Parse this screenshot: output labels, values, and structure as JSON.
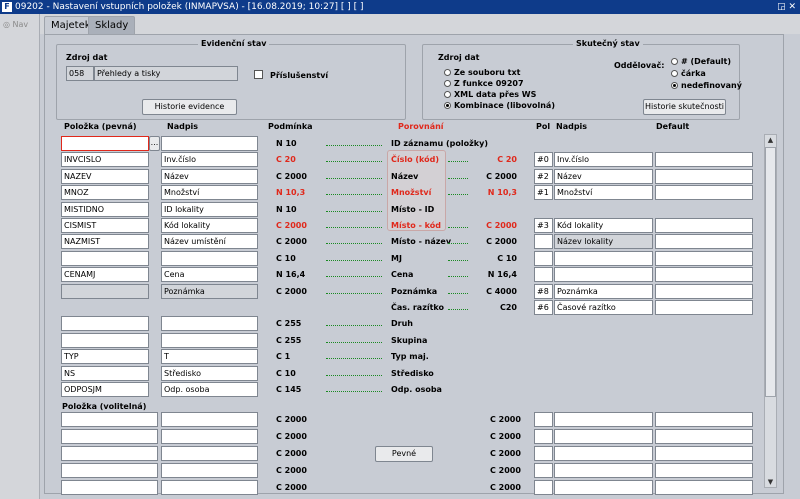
{
  "window": {
    "title": "09202 - Nastavení vstupních položek (INMAPVSA) - [16.08.2019; 10:27]  [ ]  [ ]",
    "icon": "app-icon",
    "controls": "◲ ✕"
  },
  "nav": {
    "label": "Nav"
  },
  "tabs": [
    {
      "label": "Majetek",
      "active": true
    },
    {
      "label": "Sklady",
      "active": false
    }
  ],
  "evid": {
    "title": "Evidenční stav",
    "source_label": "Zdroj dat",
    "source_code": "058",
    "source_name": "Přehledy a tisky",
    "accessory_label": "Příslušenství",
    "history_button": "Historie evidence"
  },
  "actual": {
    "title": "Skutečný stav",
    "source_label": "Zdroj dat",
    "options": [
      {
        "label": "Ze souboru txt",
        "selected": false
      },
      {
        "label": "Z funkce 09207",
        "selected": false
      },
      {
        "label": "XML data přes WS",
        "selected": false
      },
      {
        "label": "Kombinace (libovolná)",
        "selected": true
      }
    ],
    "separator_label": "Oddělovač:",
    "separators": [
      {
        "label": "# (Default)",
        "selected": false
      },
      {
        "label": "čárka",
        "selected": false
      },
      {
        "label": "nedefinovaný",
        "selected": true
      }
    ],
    "history_button": "Historie skutečnosti"
  },
  "headers": {
    "item": "Položka  (pevná)",
    "caption": "Nadpis",
    "condition": "Podmínka",
    "compare": "Porovnání",
    "pol": "Pol",
    "caption2": "Nadpis",
    "default": "Default"
  },
  "rows": [
    {
      "item": "",
      "caption": "",
      "cond": "N 10",
      "cond_red": false,
      "cmp": "ID záznamu (položky)",
      "cmp_red": false,
      "rcond": "",
      "pol": "",
      "cap2": "",
      "def": "",
      "has_right": false,
      "dots_r": false
    },
    {
      "item": "INVCISLO",
      "caption": "Inv.číslo",
      "cond": "C 20",
      "cond_red": true,
      "cmp": "Číslo (kód)",
      "cmp_red": true,
      "rcond": "C 20",
      "rcond_red": true,
      "pol": "#0",
      "cap2": "Inv.číslo",
      "def": "",
      "has_right": true,
      "dots_r": true
    },
    {
      "item": "NAZEV",
      "caption": "Název",
      "cond": "C 2000",
      "cond_red": false,
      "cmp": "Název",
      "cmp_red": false,
      "rcond": "C 2000",
      "pol": "#2",
      "cap2": "Název",
      "def": "",
      "has_right": true,
      "dots_r": true
    },
    {
      "item": "MNOZ",
      "caption": "Množství",
      "cond": "N 10,3",
      "cond_red": true,
      "cmp": "Množství",
      "cmp_red": true,
      "rcond": "N 10,3",
      "rcond_red": true,
      "pol": "#1",
      "cap2": "Množství",
      "def": "",
      "has_right": true,
      "dots_r": true
    },
    {
      "item": "MISTIDNO",
      "caption": "ID lokality",
      "cond": "N 10",
      "cond_red": false,
      "cmp": "Místo - ID",
      "cmp_red": false,
      "rcond": "",
      "pol": "",
      "cap2": "",
      "def": "",
      "has_right": false,
      "dots_r": false
    },
    {
      "item": "CISMIST",
      "caption": "Kód lokality",
      "cond": "C 2000",
      "cond_red": true,
      "cmp": "Místo - kód",
      "cmp_red": true,
      "rcond": "C 2000",
      "rcond_red": true,
      "pol": "#3",
      "cap2": "Kód lokality",
      "def": "",
      "has_right": true,
      "dots_r": true
    },
    {
      "item": "NAZMIST",
      "caption": "Název umístění",
      "cond": "C 2000",
      "cond_red": false,
      "cmp": "Místo - název",
      "cmp_red": false,
      "rcond": "C 2000",
      "pol": "",
      "cap2": "Název lokality",
      "def": "",
      "has_right": true,
      "cap2_dis": true,
      "dots_r": true
    },
    {
      "item": "",
      "caption": "",
      "cond": "C 10",
      "cond_red": false,
      "cmp": "MJ",
      "cmp_red": false,
      "rcond": "C 10",
      "pol": "",
      "cap2": "",
      "def": "",
      "has_right": true,
      "dots_r": true
    },
    {
      "item": "CENAMJ",
      "caption": "Cena",
      "cond": "N 16,4",
      "cond_red": false,
      "cmp": "Cena",
      "cmp_red": false,
      "rcond": "N 16,4",
      "pol": "",
      "cap2": "",
      "def": "",
      "has_right": true,
      "dots_r": true
    },
    {
      "item": "",
      "caption": "Poznámka",
      "cond": "C 2000",
      "cond_red": false,
      "cmp": "Poznámka",
      "cmp_red": false,
      "rcond": "C 4000",
      "pol": "#8",
      "cap2": "Poznámka",
      "def": "",
      "has_right": true,
      "item_dis": true,
      "cap_dis": true,
      "dots_r": true
    },
    {
      "item": null,
      "caption": null,
      "cond": "",
      "cond_red": false,
      "cmp": "Čas. razítko",
      "cmp_red": false,
      "rcond": "C20",
      "pol": "#6",
      "cap2": "Časové razítko",
      "def": "",
      "has_right": true,
      "dots_r": true,
      "no_left": true
    },
    {
      "item": "",
      "caption": "",
      "cond": "C 255",
      "cond_red": false,
      "cmp": "Druh",
      "cmp_red": false,
      "rcond": "",
      "pol": "",
      "cap2": "",
      "def": "",
      "has_right": false,
      "dots_r": false
    },
    {
      "item": "",
      "caption": "",
      "cond": "C 255",
      "cond_red": false,
      "cmp": "Skupina",
      "cmp_red": false,
      "rcond": "",
      "pol": "",
      "cap2": "",
      "def": "",
      "has_right": false,
      "dots_r": false
    },
    {
      "item": "TYP",
      "caption": "T",
      "cond": "C 1",
      "cond_red": false,
      "cmp": "Typ maj.",
      "cmp_red": false,
      "rcond": "",
      "pol": "",
      "cap2": "",
      "def": "",
      "has_right": false,
      "dots_r": false
    },
    {
      "item": "NS",
      "caption": "Středisko",
      "cond": "C 10",
      "cond_red": false,
      "cmp": "Středisko",
      "cmp_red": false,
      "rcond": "",
      "pol": "",
      "cap2": "",
      "def": "",
      "has_right": false,
      "dots_r": false
    },
    {
      "item": "ODPOSJM",
      "caption": "Odp. osoba",
      "cond": "C 145",
      "cond_red": false,
      "cmp": "Odp. osoba",
      "cmp_red": false,
      "rcond": "",
      "pol": "",
      "cap2": "",
      "def": "",
      "has_right": false,
      "dots_r": false
    }
  ],
  "optional": {
    "label": "Položka   (volitelná)",
    "cond": "C 2000",
    "rows": 5,
    "fixed_button": "Pevné"
  },
  "colors": {
    "red": "#e0281b",
    "dots": "#1a8a22",
    "title_bg": "#0e3b8a"
  }
}
